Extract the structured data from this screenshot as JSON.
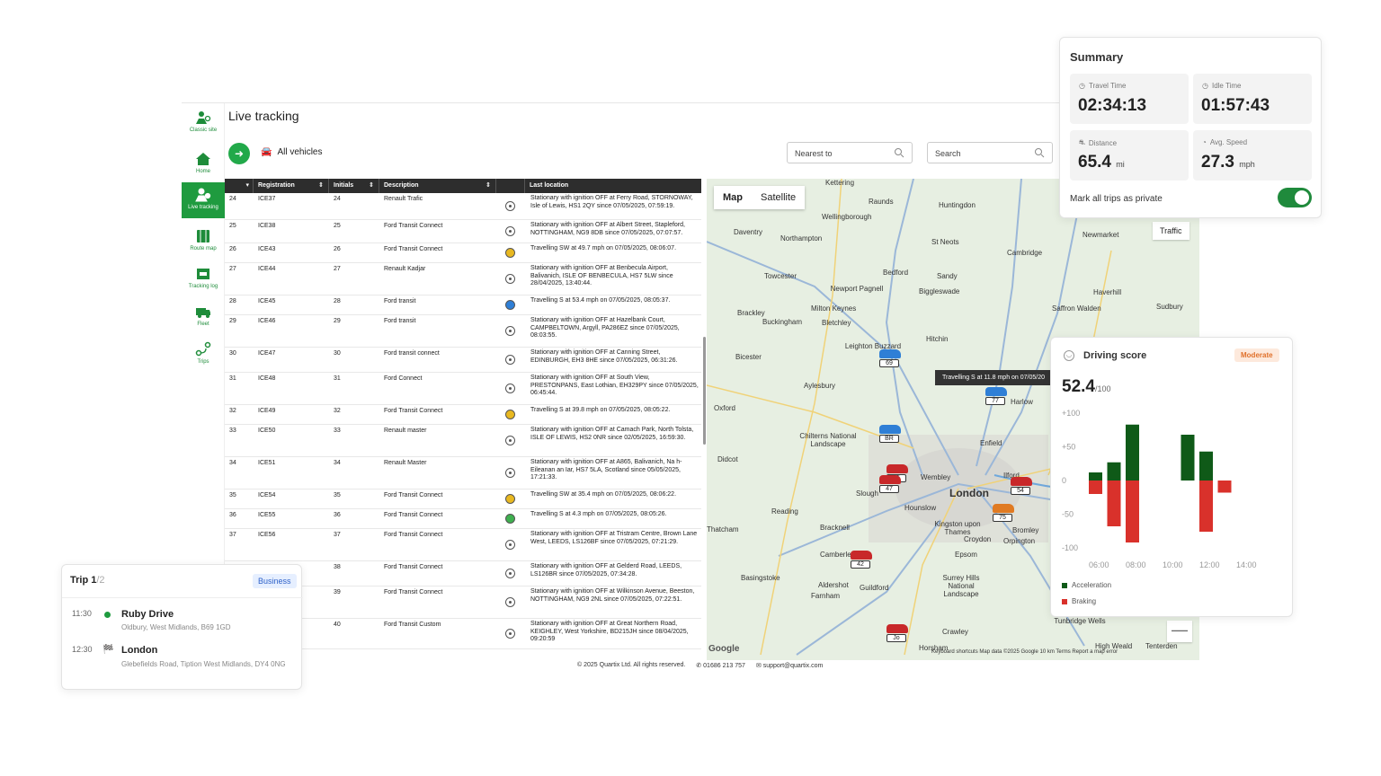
{
  "sidebar": {
    "items": [
      {
        "label": "Classic site",
        "icon": "classic-site-icon"
      },
      {
        "label": "Home",
        "icon": "home-icon"
      },
      {
        "label": "Live tracking",
        "icon": "live-tracking-icon",
        "active": true
      },
      {
        "label": "Route map",
        "icon": "route-map-icon"
      },
      {
        "label": "Tracking log",
        "icon": "tracking-log-icon"
      },
      {
        "label": "Fleet",
        "icon": "fleet-icon"
      },
      {
        "label": "Trips",
        "icon": "trips-icon"
      }
    ]
  },
  "header": {
    "title": "Live tracking",
    "vehicles_filter": "All vehicles",
    "nearest_placeholder": "Nearest to",
    "search_placeholder": "Search"
  },
  "table": {
    "columns": [
      "Registration",
      "Initials",
      "Description",
      "Last location"
    ],
    "rows": [
      {
        "n": "24",
        "reg": "ICE37",
        "ini": "24",
        "desc": "Renault Trafic",
        "status": "stationary",
        "loc": "Stationary with ignition OFF at Ferry Road, STORNOWAY, Isle of Lewis, HS1 2QY since 07/05/2025, 07:59:19."
      },
      {
        "n": "25",
        "reg": "ICE38",
        "ini": "25",
        "desc": "Ford Transit Connect",
        "status": "stationary",
        "loc": "Stationary with ignition OFF at Albert Street, Stapleford, NOTTINGHAM, NG9 8DB since 07/05/2025, 07:07:57."
      },
      {
        "n": "26",
        "reg": "ICE43",
        "ini": "26",
        "desc": "Ford Transit Connect",
        "status": "moving",
        "color": "#e8b820",
        "loc": "Travelling SW at 49.7 mph on 07/05/2025, 08:06:07."
      },
      {
        "n": "27",
        "reg": "ICE44",
        "ini": "27",
        "desc": "Renault Kadjar",
        "status": "stationary",
        "loc": "Stationary with ignition OFF at Benbecula Airport, Balivanich, ISLE OF BENBECULA, HS7 5LW since 28/04/2025, 13:40:44."
      },
      {
        "n": "28",
        "reg": "ICE45",
        "ini": "28",
        "desc": "Ford transit",
        "status": "moving",
        "color": "#2f7fd6",
        "loc": "Travelling S at 53.4 mph on 07/05/2025, 08:05:37."
      },
      {
        "n": "29",
        "reg": "ICE46",
        "ini": "29",
        "desc": "Ford transit",
        "status": "stationary",
        "loc": "Stationary with ignition OFF at Hazelbank Court, CAMPBELTOWN, Argyll, PA286EZ since 07/05/2025, 08:03:55."
      },
      {
        "n": "30",
        "reg": "ICE47",
        "ini": "30",
        "desc": "Ford transit connect",
        "status": "stationary",
        "loc": "Stationary with ignition OFF at Canning Street, EDINBURGH, EH3 8HE since 07/05/2025, 06:31:26."
      },
      {
        "n": "31",
        "reg": "ICE48",
        "ini": "31",
        "desc": "Ford Connect",
        "status": "stationary",
        "loc": "Stationary with ignition OFF at South View, PRESTONPANS, East Lothian, EH329PY since 07/05/2025, 06:45:44."
      },
      {
        "n": "32",
        "reg": "ICE49",
        "ini": "32",
        "desc": "Ford Transit Connect",
        "status": "moving",
        "color": "#e8b820",
        "loc": "Travelling S at 39.8 mph on 07/05/2025, 08:05:22."
      },
      {
        "n": "33",
        "reg": "ICE50",
        "ini": "33",
        "desc": "Renault master",
        "status": "stationary",
        "loc": "Stationary with ignition OFF at Camach Park, North Tolsta, ISLE OF LEWIS, HS2 0NR since 02/05/2025, 16:59:30."
      },
      {
        "n": "34",
        "reg": "ICE51",
        "ini": "34",
        "desc": "Renault Master",
        "status": "stationary",
        "loc": "Stationary with ignition OFF at A865, Balivanich, Na h-Eileanan an Iar, HS7 5LA, Scotland since 05/05/2025, 17:21:33."
      },
      {
        "n": "35",
        "reg": "ICE54",
        "ini": "35",
        "desc": "Ford Transit Connect",
        "status": "moving",
        "color": "#e8b820",
        "loc": "Travelling SW at 35.4 mph on 07/05/2025, 08:06:22."
      },
      {
        "n": "36",
        "reg": "ICE55",
        "ini": "36",
        "desc": "Ford Transit Connect",
        "status": "moving",
        "color": "#3fb04f",
        "loc": "Travelling S at 4.3 mph on 07/05/2025, 08:05:26."
      },
      {
        "n": "37",
        "reg": "ICE56",
        "ini": "37",
        "desc": "Ford Transit Connect",
        "status": "stationary",
        "loc": "Stationary with ignition OFF at Tristram Centre, Brown Lane West, LEEDS, LS126BF since 07/05/2025, 07:21:29."
      },
      {
        "n": "",
        "reg": "",
        "ini": "38",
        "desc": "Ford Transit Connect",
        "status": "stationary",
        "loc": "Stationary with ignition OFF at Gelderd Road, LEEDS, LS126BR since 07/05/2025, 07:34:28."
      },
      {
        "n": "",
        "reg": "",
        "ini": "39",
        "desc": "Ford Transit Connect",
        "status": "stationary",
        "loc": "Stationary with ignition OFF at Wilkinson Avenue, Beeston, NOTTINGHAM, NG9 2NL since 07/05/2025, 07:22:51."
      },
      {
        "n": "",
        "reg": "",
        "ini": "40",
        "desc": "Ford Transit Custom",
        "status": "stationary",
        "loc": "Stationary with ignition OFF at Great Northern Road, KEIGHLEY, West Yorkshire, BD215JH since 08/04/2025, 09:20:59"
      }
    ]
  },
  "footer": {
    "copyright": "2025 Quartix Ltd. All rights reserved.",
    "phone": "01686 213 757",
    "email": "support@quartix.com"
  },
  "map": {
    "mode_map": "Map",
    "mode_satellite": "Satellite",
    "traffic": "Traffic",
    "tooltip": "Travelling S at 11.8 mph on 07/05/20",
    "credits": "Keyboard shortcuts   Map data ©2025 Google   10 km          Terms   Report a map error",
    "google": "Google",
    "places": [
      {
        "name": "Kettering"
      },
      {
        "name": "Wellingborough"
      },
      {
        "name": "Raunds"
      },
      {
        "name": "Huntingdon"
      },
      {
        "name": "Daventry"
      },
      {
        "name": "Northampton"
      },
      {
        "name": "St Neots"
      },
      {
        "name": "Cambridge"
      },
      {
        "name": "Towcester"
      },
      {
        "name": "Bedford"
      },
      {
        "name": "Sandy"
      },
      {
        "name": "Newport Pagnell"
      },
      {
        "name": "Biggleswade"
      },
      {
        "name": "Milton Keynes"
      },
      {
        "name": "Brackley"
      },
      {
        "name": "Buckingham"
      },
      {
        "name": "Bletchley"
      },
      {
        "name": "Saffron Walden"
      },
      {
        "name": "Haverhill"
      },
      {
        "name": "Sudbury"
      },
      {
        "name": "Newmarket"
      },
      {
        "name": "Leighton Buzzard"
      },
      {
        "name": "Hitchin"
      },
      {
        "name": "Bicester"
      },
      {
        "name": "Aylesbury"
      },
      {
        "name": "Oxford"
      },
      {
        "name": "Harlow"
      },
      {
        "name": "Chilterns National Landscape"
      },
      {
        "name": "Enfield"
      },
      {
        "name": "Didcot"
      },
      {
        "name": "Wembley"
      },
      {
        "name": "Ilford"
      },
      {
        "name": "Slough"
      },
      {
        "name": "London",
        "big": true
      },
      {
        "name": "Reading"
      },
      {
        "name": "Hounslow"
      },
      {
        "name": "Kingston upon Thames"
      },
      {
        "name": "Bracknell"
      },
      {
        "name": "Bromley"
      },
      {
        "name": "Croydon"
      },
      {
        "name": "Orpington"
      },
      {
        "name": "Thatcham"
      },
      {
        "name": "Camberley"
      },
      {
        "name": "Epsom"
      },
      {
        "name": "Basingstoke"
      },
      {
        "name": "Aldershot"
      },
      {
        "name": "Guildford"
      },
      {
        "name": "Surrey Hills National Landscape"
      },
      {
        "name": "Farnham"
      },
      {
        "name": "Crawley"
      },
      {
        "name": "Horsham"
      },
      {
        "name": "High Weald"
      },
      {
        "name": "Tenterden"
      },
      {
        "name": "Tunbridge Wells"
      }
    ],
    "vehicles": [
      {
        "label": "69",
        "color": "#2f7fd6"
      },
      {
        "label": "77",
        "color": "#2f7fd6"
      },
      {
        "label": "BR",
        "color": "#2f7fd6"
      },
      {
        "label": "15",
        "color": "#c8282a"
      },
      {
        "label": "47",
        "color": "#c8282a"
      },
      {
        "label": "54",
        "color": "#c8282a"
      },
      {
        "label": "75",
        "color": "#e07a22"
      },
      {
        "label": "42",
        "color": "#c8282a"
      },
      {
        "label": "Jo",
        "color": "#c8282a"
      }
    ]
  },
  "summary": {
    "title": "Summary",
    "travel_label": "Travel Time",
    "travel_value": "02:34:13",
    "idle_label": "Idle Time",
    "idle_value": "01:57:43",
    "distance_label": "Distance",
    "distance_value": "65.4",
    "distance_unit": "mi",
    "speed_label": "Avg. Speed",
    "speed_value": "27.3",
    "speed_unit": "mph",
    "private_label": "Mark all trips as private",
    "private_on": true
  },
  "driving": {
    "title": "Driving score",
    "badge": "Moderate",
    "score": "52.4",
    "score_suffix": "/100",
    "legend_accel": "Acceleration",
    "legend_brake": "Braking"
  },
  "chart_data": {
    "type": "bar",
    "ylim": [
      -100,
      100
    ],
    "yticks": [
      "+100",
      "+50",
      "0",
      "-50",
      "-100"
    ],
    "xticks": [
      "06:00",
      "08:00",
      "10:00",
      "12:00",
      "14:00"
    ],
    "series": [
      {
        "name": "Acceleration",
        "color": "#0f5a18",
        "values": [
          12,
          27,
          83,
          0,
          0,
          68,
          43,
          0
        ]
      },
      {
        "name": "Braking",
        "color": "#d9312b",
        "values": [
          -20,
          -68,
          -92,
          0,
          0,
          0,
          -76,
          -18
        ]
      }
    ]
  },
  "trip": {
    "title": "Trip 1",
    "of": "/2",
    "badge": "Business",
    "stops": [
      {
        "time": "11:30",
        "name": "Ruby Drive",
        "addr": "Oldbury, West Midlands, B69 1GD"
      },
      {
        "time": "12:30",
        "name": "London",
        "addr": "Glebefields Road, Tiption West Midlands, DY4 0NG"
      }
    ]
  }
}
